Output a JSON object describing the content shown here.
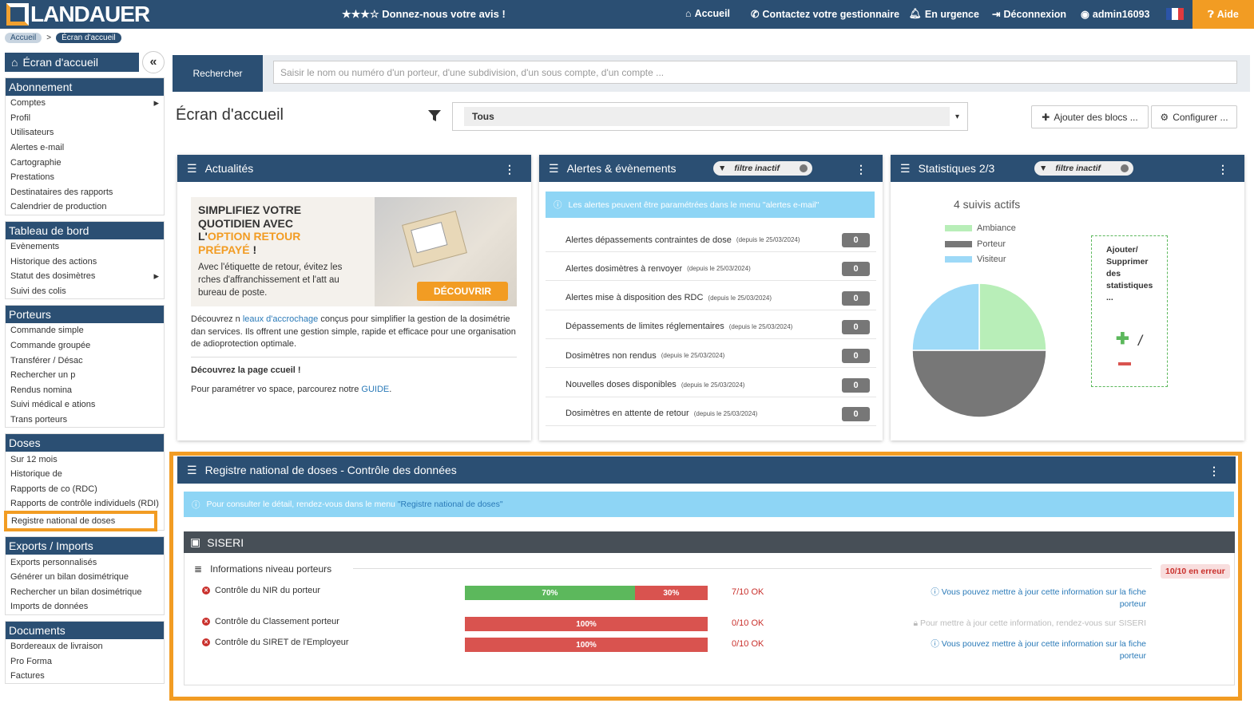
{
  "topbar": {
    "logo": "LANDAUER",
    "feedback": "★★★☆ Donnez-nous votre avis !",
    "nav": [
      {
        "icon": "home-icon",
        "label": "Accueil"
      },
      {
        "icon": "phone-icon",
        "label": "Contactez votre gestionnaire"
      },
      {
        "icon": "bell-icon",
        "label": "En urgence"
      },
      {
        "icon": "logout-icon",
        "label": "Déconnexion"
      },
      {
        "icon": "user-icon",
        "label": "admin16093"
      }
    ],
    "help": "Aide"
  },
  "breadcrumb": [
    "Accueil",
    "Écran d'accueil"
  ],
  "sidebar": {
    "home": "Écran d'accueil",
    "sections": [
      {
        "title": "Abonnement",
        "items": [
          "Comptes",
          "Profil",
          "Utilisateurs",
          "Alertes e-mail",
          "Cartographie",
          "Prestations",
          "Destinataires des rapports",
          "Calendrier de production"
        ]
      },
      {
        "title": "Tableau de bord",
        "items": [
          "Evènements",
          "Historique des actions",
          "Statut des dosimètres",
          "Suivi des colis"
        ]
      },
      {
        "title": "Porteurs",
        "items": [
          "Commande simple",
          "Commande groupée",
          "Transférer / Désac",
          "Rechercher un p",
          "Rendus nomina",
          "Suivi médical e         ations",
          "Trans               porteurs"
        ]
      },
      {
        "title": "Doses",
        "items": [
          "Sur 12 mois",
          "Historique de",
          "Rapports de co        (RDC)",
          "Rapports de contrôle individuels (RDI)",
          "Registre national de doses"
        ]
      },
      {
        "title": "Exports / Imports",
        "items": [
          "Exports personnalisés",
          "Générer un bilan dosimétrique",
          "Rechercher un bilan dosimétrique",
          "Imports de données"
        ]
      },
      {
        "title": "Documents",
        "items": [
          "Bordereaux de livraison",
          "Pro Forma",
          "Factures"
        ]
      }
    ]
  },
  "search": {
    "button": "Rechercher",
    "placeholder": "Saisir le nom ou numéro d'un porteur, d'une subdivision, d'un sous compte, d'un compte ..."
  },
  "main": {
    "title": "Écran d'accueil",
    "filter_value": "Tous",
    "add_blocks": "Ajouter des blocs ...",
    "configure": "Configurer ..."
  },
  "actualites": {
    "title": "Actualités",
    "ad_line1": "SIMPLIFIEZ VOTRE",
    "ad_line2": "QUOTIDIEN AVEC",
    "ad_line3a": "L'",
    "ad_line3b": "OPTION RETOUR",
    "ad_line4": "PRÉPAYÉ",
    "ad_line4b": " !",
    "ad_sub": "Avec l'étiquette de retour, évitez les      rches d'affranchissement et l'att      au bureau de poste.",
    "ad_button": "DÉCOUVRIR",
    "p1a": "Découvrez n",
    "p1link": "     leaux d'accrochage",
    "p1b": " conçus pour simplifier la gestion de la dosimétrie dan      services. Ils offrent une gestion simple, rapide et efficace pour une organisation de          adioprotection optimale.",
    "p2": "Découvrez la page        ccueil !",
    "p3a": "Pour paramétrer vo         space, parcourez notre ",
    "p3link": "GUIDE",
    "p3b": "."
  },
  "alertes": {
    "title": "Alertes & évènements",
    "filter": "filtre inactif",
    "info": "Les alertes peuvent être paramétrées dans le menu \"alertes e-mail\"",
    "rows": [
      {
        "label": "Alertes dépassements contraintes de dose",
        "since": "(depuis le 25/03/2024)",
        "count": "0"
      },
      {
        "label": "Alertes dosimètres à renvoyer",
        "since": "(depuis le 25/03/2024)",
        "count": "0"
      },
      {
        "label": "Alertes mise à disposition des RDC",
        "since": "(depuis le 25/03/2024)",
        "count": "0"
      },
      {
        "label": "Dépassements de limites réglementaires",
        "since": "(depuis le 25/03/2024)",
        "count": "0"
      },
      {
        "label": "Dosimètres non rendus",
        "since": "(depuis le 25/03/2024)",
        "count": "0"
      },
      {
        "label": "Nouvelles doses disponibles",
        "since": "(depuis le 25/03/2024)",
        "count": "0"
      },
      {
        "label": "Dosimètres en attente de retour",
        "since": "(depuis le 25/03/2024)",
        "count": "0"
      }
    ]
  },
  "stats": {
    "title": "Statistiques 2/3",
    "filter": "filtre inactif",
    "subtitle": "4 suivis actifs",
    "add_label": "Ajouter/ Supprimer des statistiques ...",
    "add_sep": "/"
  },
  "chart_data": {
    "type": "pie",
    "categories": [
      "Ambiance",
      "Porteur",
      "Visiteur"
    ],
    "values": [
      1,
      2,
      1
    ],
    "colors": [
      "#b8eeb8",
      "#777777",
      "#9dd9f7"
    ]
  },
  "registre": {
    "title": "Registre national de doses - Contrôle des données",
    "info_a": "Pour consulter le détail, rendez-vous dans le menu ",
    "info_link": "\"Registre national de doses\"",
    "siseri": "SISERI",
    "section": "Informations niveau porteurs",
    "error_badge": "10/10 en erreur",
    "controls": [
      {
        "label": "Contrôle du NIR du porteur",
        "ok_pct": 70,
        "ok_label": "70%",
        "ko_label": "30%",
        "status": "7/10 OK",
        "note": "Vous pouvez mettre à jour cette information sur la fiche porteur"
      },
      {
        "label": "Contrôle du Classement porteur",
        "ok_pct": 0,
        "ok_label": "",
        "ko_label": "100%",
        "status": "0/10 OK",
        "note": "Pour mettre à jour cette information, rendez-vous sur SISERI"
      },
      {
        "label": "Contrôle du SIRET de l'Employeur",
        "ok_pct": 0,
        "ok_label": "",
        "ko_label": "100%",
        "status": "0/10 OK",
        "note": "Vous pouvez mettre à jour cette information sur la fiche porteur"
      }
    ]
  },
  "colors": {
    "primary": "#2b4f73",
    "accent": "#f29c23",
    "success": "#5cb85c",
    "danger": "#d9534f",
    "info": "#8ed5f5"
  }
}
